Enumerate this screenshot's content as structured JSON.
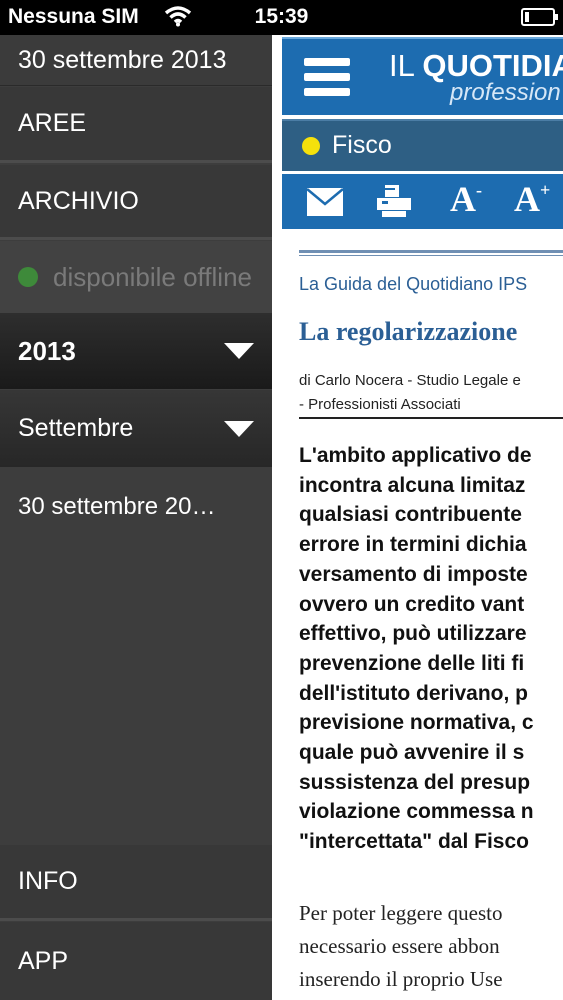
{
  "status_bar": {
    "carrier": "Nessuna SIM",
    "time": "15:39",
    "icons": [
      "wifi-icon",
      "battery-icon"
    ]
  },
  "sidebar": {
    "current_date": "30 settembre 2013",
    "aree_label": "AREE",
    "archivio_label": "ARCHIVIO",
    "offline_label": "disponibile offline",
    "year_label": "2013",
    "month_label": "Settembre",
    "issue_label": "30 settembre 20…",
    "info_label": "INFO",
    "app_label": "APP",
    "offline_status_color": "#3e8a3a"
  },
  "header": {
    "logo_prefix": "IL",
    "logo_main": "QUOTIDIA",
    "logo_sub": "profession",
    "brand_color": "#1d6cb0"
  },
  "section": {
    "label": "Fisco",
    "dot_color": "#f5e10c"
  },
  "toolbar": {
    "font_minus_label": "A",
    "font_minus_sup": "-",
    "font_plus_label": "A",
    "font_plus_sup": "+",
    "icons": [
      "mail-icon",
      "print-icon",
      "font-decrease-icon",
      "font-increase-icon"
    ]
  },
  "article": {
    "guide": "La Guida del Quotidiano IPS",
    "title": "La regolarizzazione",
    "author_line1": "di Carlo Nocera - Studio Legale e",
    "author_line2": "- Professionisti Associati",
    "lead_lines": [
      "L'ambito applicativo de",
      "incontra alcuna limitaz",
      "qualsiasi contribuente",
      "errore in termini dichia",
      "versamento di imposte",
      "ovvero un credito vant",
      "effettivo, può utilizzare",
      "prevenzione delle liti fi",
      "dell'istituto derivano, p",
      "previsione normativa, c",
      "quale può avvenire il s",
      "sussistenza del presup",
      "violazione commessa n",
      "\"intercettata\" dal Fisco"
    ],
    "body_lines": [
      "Per poter leggere questo",
      "necessario essere abbon",
      "inserendo il proprio Use"
    ]
  }
}
